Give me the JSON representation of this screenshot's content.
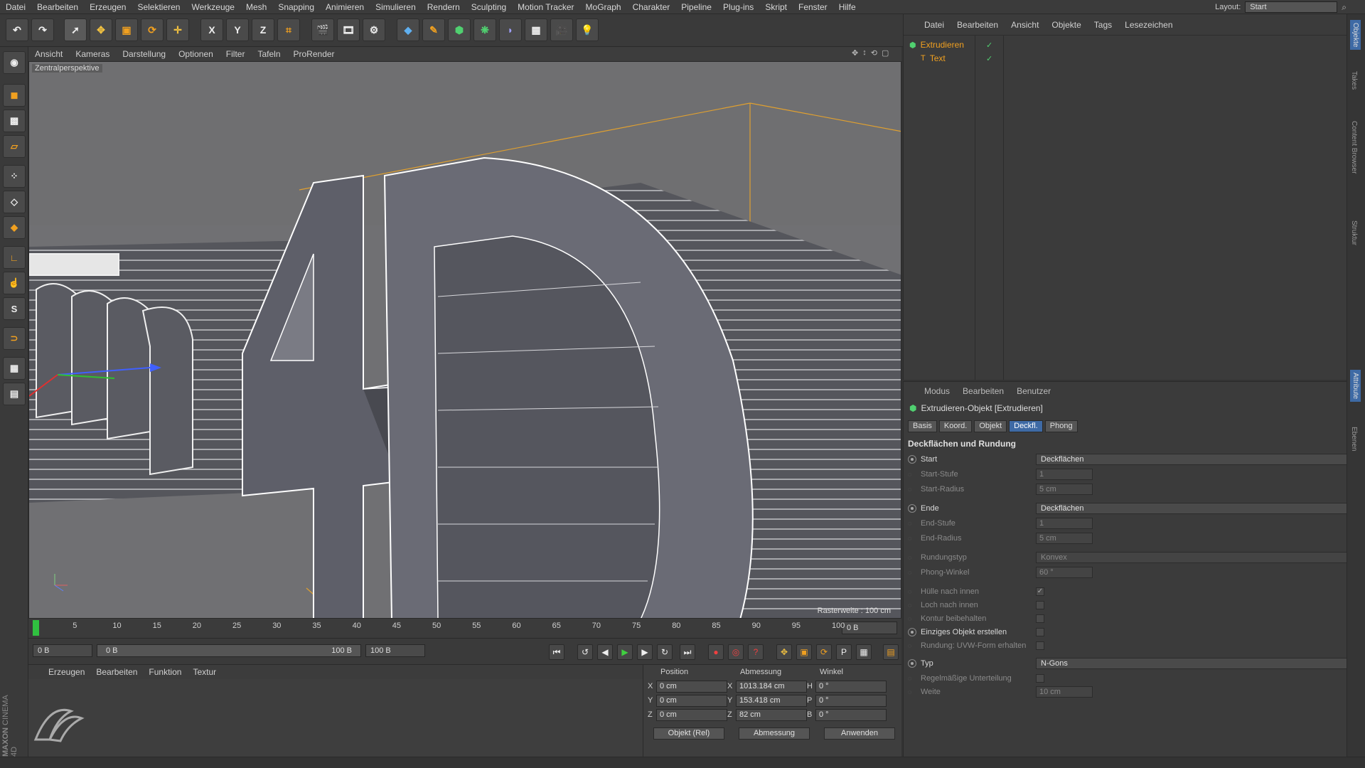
{
  "menubar": {
    "items": [
      "Datei",
      "Bearbeiten",
      "Erzeugen",
      "Selektieren",
      "Werkzeuge",
      "Mesh",
      "Snapping",
      "Animieren",
      "Simulieren",
      "Rendern",
      "Sculpting",
      "Motion Tracker",
      "MoGraph",
      "Charakter",
      "Pipeline",
      "Plug-ins",
      "Skript",
      "Fenster",
      "Hilfe"
    ],
    "layout_label": "Layout:",
    "layout_value": "Start"
  },
  "toolbar": {
    "axis_x": "X",
    "axis_y": "Y",
    "axis_z": "Z"
  },
  "viewport_menu": {
    "items": [
      "Ansicht",
      "Kameras",
      "Darstellung",
      "Optionen",
      "Filter",
      "Tafeln",
      "ProRender"
    ]
  },
  "viewport": {
    "camera_label": "Zentralperspektive",
    "grid_label": "Rasterweite : 100 cm",
    "scene_text": "Cinema 4D"
  },
  "timeline": {
    "ticks": [
      "0",
      "5",
      "10",
      "15",
      "20",
      "25",
      "30",
      "35",
      "40",
      "45",
      "50",
      "55",
      "60",
      "65",
      "70",
      "75",
      "80",
      "85",
      "90",
      "95",
      "100"
    ],
    "current_frame": "0 B",
    "current_frame_position": 0
  },
  "transport": {
    "start_field": "0 B",
    "range_start": "0 B",
    "range_end": "100 B",
    "end_field": "100 B"
  },
  "material_manager": {
    "menu": [
      "Erzeugen",
      "Bearbeiten",
      "Funktion",
      "Textur"
    ]
  },
  "coordinates": {
    "headers": {
      "position": "Position",
      "size": "Abmessung",
      "rotation": "Winkel"
    },
    "rows": [
      {
        "axis": "X",
        "pos": "0 cm",
        "size_axis": "X",
        "size": "1013.184 cm",
        "rot_axis": "H",
        "rot": "0 °"
      },
      {
        "axis": "Y",
        "pos": "0 cm",
        "size_axis": "Y",
        "size": "153.418 cm",
        "rot_axis": "P",
        "rot": "0 °"
      },
      {
        "axis": "Z",
        "pos": "0 cm",
        "size_axis": "Z",
        "size": "82 cm",
        "rot_axis": "B",
        "rot": "0 °"
      }
    ],
    "mode_select": "Objekt (Rel)",
    "size_select": "Abmessung",
    "apply": "Anwenden"
  },
  "object_manager": {
    "menu": [
      "Datei",
      "Bearbeiten",
      "Ansicht",
      "Objekte",
      "Tags",
      "Lesezeichen"
    ],
    "objects": [
      {
        "name": "Extrudieren",
        "level": 0
      },
      {
        "name": "Text",
        "level": 1
      }
    ]
  },
  "attribute_manager": {
    "menu": [
      "Modus",
      "Bearbeiten",
      "Benutzer"
    ],
    "title": "Extrudieren-Objekt [Extrudieren]",
    "tabs": [
      "Basis",
      "Koord.",
      "Objekt",
      "Deckfl.",
      "Phong"
    ],
    "active_tab": "Deckfl.",
    "section": "Deckflächen und Rundung",
    "props": [
      {
        "label": "Start",
        "type": "drop",
        "value": "Deckflächen",
        "enabled": true,
        "radio": true
      },
      {
        "label": "Start-Stufe",
        "type": "field",
        "value": "1",
        "enabled": false
      },
      {
        "label": "Start-Radius",
        "type": "field",
        "value": "5 cm",
        "enabled": false
      },
      {
        "label": "Ende",
        "type": "drop",
        "value": "Deckflächen",
        "enabled": true,
        "radio": true
      },
      {
        "label": "End-Stufe",
        "type": "field",
        "value": "1",
        "enabled": false
      },
      {
        "label": "End-Radius",
        "type": "field",
        "value": "5 cm",
        "enabled": false
      },
      {
        "label": "Rundungstyp",
        "type": "drop",
        "value": "Konvex",
        "enabled": false
      },
      {
        "label": "Phong-Winkel",
        "type": "field",
        "value": "60 °",
        "enabled": false
      },
      {
        "label": "Hülle nach innen",
        "type": "check",
        "value": "✓",
        "enabled": false
      },
      {
        "label": "Loch nach innen",
        "type": "check",
        "value": "",
        "enabled": false
      },
      {
        "label": "Kontur beibehalten",
        "type": "check",
        "value": "",
        "enabled": false
      },
      {
        "label": "Einziges Objekt erstellen",
        "type": "check",
        "value": "",
        "enabled": true,
        "radio": true
      },
      {
        "label": "Rundung: UVW-Form erhalten",
        "type": "check",
        "value": "",
        "enabled": false
      },
      {
        "label": "Typ",
        "type": "drop",
        "value": "N-Gons",
        "enabled": true,
        "radio": true
      },
      {
        "label": "Regelmäßige Unterteilung",
        "type": "check",
        "value": "",
        "enabled": false
      },
      {
        "label": "Weite",
        "type": "field",
        "value": "10 cm",
        "enabled": false
      }
    ]
  },
  "right_tabs": [
    "Objekte",
    "Takes",
    "Content Browser",
    "Struktur",
    "Attribute",
    "Ebenen"
  ],
  "brand": {
    "line1": "MAXON",
    "line2": "CINEMA 4D"
  },
  "colors": {
    "accent": "#3e6aa5",
    "object_name": "#f0a020",
    "viewport_bg": "#6f6f71"
  }
}
